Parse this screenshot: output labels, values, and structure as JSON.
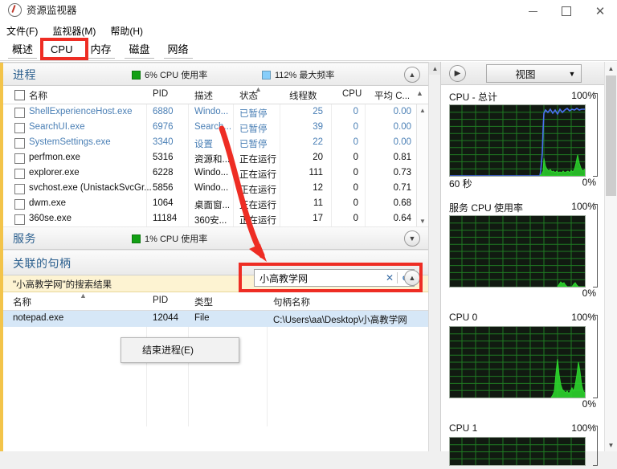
{
  "window": {
    "title": "资源监视器",
    "icon": "resource-monitor-icon",
    "controls": {
      "minimize": "–",
      "maximize": "▢",
      "close": "✕"
    }
  },
  "menu": [
    {
      "label": "文件(F)"
    },
    {
      "label": "监视器(M)"
    },
    {
      "label": "帮助(H)"
    }
  ],
  "tabs": [
    {
      "label": "概述",
      "active": false
    },
    {
      "label": "CPU",
      "active": true
    },
    {
      "label": "内存",
      "active": false
    },
    {
      "label": "磁盘",
      "active": false
    },
    {
      "label": "网络",
      "active": false
    }
  ],
  "processes_section": {
    "title": "进程",
    "legend": [
      {
        "label": "6% CPU 使用率",
        "color": "#12a014"
      },
      {
        "label": "112% 最大频率",
        "color": "#87cefa"
      }
    ],
    "collapse_icon": "chevron-up-icon",
    "columns": [
      {
        "key": "name",
        "label": "名称"
      },
      {
        "key": "pid",
        "label": "PID"
      },
      {
        "key": "desc",
        "label": "描述"
      },
      {
        "key": "status",
        "label": "状态"
      },
      {
        "key": "threads",
        "label": "线程数"
      },
      {
        "key": "cpu",
        "label": "CPU"
      },
      {
        "key": "avgcpu",
        "label": "平均 C..."
      }
    ],
    "sorted_column": "状态",
    "rows": [
      {
        "name": "ShellExperienceHost.exe",
        "pid": "6880",
        "desc": "Windo...",
        "status": "已暂停",
        "threads": "25",
        "cpu": "0",
        "avgcpu": "0.00",
        "dim": true
      },
      {
        "name": "SearchUI.exe",
        "pid": "6976",
        "desc": "Search...",
        "status": "已暂停",
        "threads": "39",
        "cpu": "0",
        "avgcpu": "0.00",
        "dim": true
      },
      {
        "name": "SystemSettings.exe",
        "pid": "3340",
        "desc": "设置",
        "status": "已暂停",
        "threads": "22",
        "cpu": "0",
        "avgcpu": "0.00",
        "dim": true
      },
      {
        "name": "perfmon.exe",
        "pid": "5316",
        "desc": "资源和...",
        "status": "正在运行",
        "threads": "20",
        "cpu": "0",
        "avgcpu": "0.81",
        "dim": false
      },
      {
        "name": "explorer.exe",
        "pid": "6228",
        "desc": "Windo...",
        "status": "正在运行",
        "threads": "111",
        "cpu": "0",
        "avgcpu": "0.73",
        "dim": false
      },
      {
        "name": "svchost.exe (UnistackSvcGr...",
        "pid": "5856",
        "desc": "Windo...",
        "status": "正在运行",
        "threads": "12",
        "cpu": "0",
        "avgcpu": "0.71",
        "dim": false
      },
      {
        "name": "dwm.exe",
        "pid": "1064",
        "desc": "桌面窗...",
        "status": "正在运行",
        "threads": "11",
        "cpu": "0",
        "avgcpu": "0.68",
        "dim": false
      },
      {
        "name": "360se.exe",
        "pid": "11184",
        "desc": "360安...",
        "status": "正在运行",
        "threads": "17",
        "cpu": "0",
        "avgcpu": "0.64",
        "dim": false
      }
    ]
  },
  "services_section": {
    "title": "服务",
    "legend": [
      {
        "label": "1% CPU 使用率",
        "color": "#12a014"
      }
    ],
    "collapse_icon": "chevron-down-icon"
  },
  "handles_section": {
    "title": "关联的句柄",
    "search": {
      "value": "小高教学网",
      "clear_icon": "clear-x-icon",
      "find_icon": "search-refresh-icon"
    },
    "collapse_icon": "chevron-up-icon",
    "result_banner": "\"小高教学网\"的搜索结果",
    "columns": [
      {
        "key": "name",
        "label": "名称"
      },
      {
        "key": "pid",
        "label": "PID"
      },
      {
        "key": "type",
        "label": "类型"
      },
      {
        "key": "handle",
        "label": "句柄名称"
      }
    ],
    "rows": [
      {
        "name": "notepad.exe",
        "pid": "12044",
        "type": "File",
        "handle": "C:\\Users\\aa\\Desktop\\小高教学网",
        "selected": true
      }
    ],
    "context_menu": [
      {
        "label": "结束进程(E)"
      }
    ]
  },
  "right_pane": {
    "expand_icon": "chevron-right-icon",
    "view_button": "视图",
    "view_dropdown_icon": "chevron-down-icon",
    "graphs": [
      {
        "title": "CPU - 总计",
        "max": "100%",
        "min": "0%",
        "unit": "60 秒"
      },
      {
        "title": "服务 CPU 使用率",
        "max": "100%",
        "min": "0%",
        "unit": ""
      },
      {
        "title": "CPU 0",
        "max": "100%",
        "min": "0%",
        "unit": ""
      },
      {
        "title": "CPU 1",
        "max": "100%",
        "min": "",
        "unit": ""
      }
    ]
  },
  "annotations": {
    "cpu_tab_box": "red-highlight-cpu-tab",
    "search_box": "red-highlight-search",
    "arrow": "red-arrow-pointing-to-search"
  },
  "colors": {
    "accent_blue": "#2b5f8e",
    "legend_green": "#12a014",
    "legend_blue": "#87cefa",
    "annotation_red": "#ee2d24",
    "banner_yellow": "#fdf3d2",
    "selection_blue": "#d6e7f7"
  },
  "chart_data": [
    {
      "type": "line",
      "title": "CPU - 总计",
      "ylim": [
        0,
        100
      ],
      "ylabel": "%",
      "xlabel": "60 秒",
      "grid": true,
      "series": [
        {
          "name": "最大频率",
          "color": "#4a6ff0",
          "values": [
            0,
            0,
            0,
            0,
            0,
            0,
            0,
            0,
            0,
            0,
            0,
            0,
            0,
            0,
            0,
            0,
            0,
            0,
            0,
            0,
            0,
            0,
            0,
            0,
            0,
            0,
            0,
            0,
            0,
            0,
            0,
            0,
            0,
            0,
            0,
            0,
            0,
            0,
            0,
            0,
            0,
            0,
            0,
            0,
            0,
            0,
            0,
            0,
            0,
            0,
            0,
            0,
            0,
            0,
            0,
            0,
            0,
            6,
            95,
            92,
            96,
            93,
            97,
            92,
            96,
            93,
            91,
            95,
            93,
            97,
            93,
            95,
            96,
            94,
            97,
            95,
            94,
            96,
            95
          ]
        },
        {
          "name": "CPU 使用率",
          "color": "#2cd42c",
          "values": [
            0,
            0,
            0,
            0,
            0,
            0,
            0,
            0,
            0,
            0,
            0,
            0,
            0,
            0,
            0,
            0,
            0,
            0,
            0,
            0,
            0,
            0,
            0,
            0,
            0,
            0,
            0,
            0,
            0,
            0,
            0,
            0,
            0,
            0,
            0,
            0,
            0,
            0,
            0,
            0,
            0,
            0,
            0,
            0,
            0,
            0,
            0,
            0,
            0,
            0,
            0,
            0,
            0,
            0,
            0,
            0,
            0,
            2,
            6,
            30,
            18,
            12,
            9,
            14,
            8,
            6,
            7,
            5,
            6,
            8,
            6,
            5,
            7,
            6,
            5,
            6,
            9,
            24,
            32
          ]
        }
      ]
    },
    {
      "type": "line",
      "title": "服务 CPU 使用率",
      "ylim": [
        0,
        100
      ],
      "ylabel": "%",
      "grid": true,
      "series": [
        {
          "name": "服务 CPU",
          "color": "#2cd42c",
          "values": [
            0,
            0,
            0,
            0,
            0,
            0,
            0,
            0,
            0,
            0,
            0,
            0,
            0,
            0,
            0,
            0,
            0,
            0,
            0,
            0,
            0,
            0,
            0,
            0,
            0,
            0,
            0,
            0,
            0,
            0,
            0,
            0,
            0,
            0,
            0,
            0,
            0,
            0,
            0,
            0,
            0,
            0,
            0,
            0,
            0,
            0,
            0,
            0,
            0,
            0,
            0,
            0,
            0,
            0,
            0,
            0,
            0,
            0,
            0,
            0,
            0,
            0,
            0,
            0,
            0,
            0,
            0,
            0,
            0,
            0,
            0,
            3,
            5,
            2,
            4,
            1,
            0,
            3,
            6
          ]
        }
      ]
    },
    {
      "type": "line",
      "title": "CPU 0",
      "ylim": [
        0,
        100
      ],
      "ylabel": "%",
      "grid": true,
      "series": [
        {
          "name": "CPU 0",
          "color": "#2cd42c",
          "values": [
            0,
            0,
            0,
            0,
            0,
            0,
            0,
            0,
            0,
            0,
            0,
            0,
            0,
            0,
            0,
            0,
            0,
            0,
            0,
            0,
            0,
            0,
            0,
            0,
            0,
            0,
            0,
            0,
            0,
            0,
            0,
            0,
            0,
            0,
            0,
            0,
            0,
            0,
            0,
            0,
            0,
            0,
            0,
            0,
            0,
            0,
            0,
            0,
            0,
            0,
            0,
            0,
            0,
            0,
            0,
            0,
            0,
            0,
            0,
            0,
            0,
            0,
            0,
            0,
            0,
            0,
            1,
            4,
            34,
            20,
            12,
            8,
            10,
            7,
            6,
            8,
            12,
            26,
            36
          ]
        }
      ]
    },
    {
      "type": "line",
      "title": "CPU 1",
      "ylim": [
        0,
        100
      ],
      "ylabel": "%",
      "grid": true,
      "series": [
        {
          "name": "CPU 1",
          "color": "#2cd42c",
          "values": [
            0,
            0,
            0,
            0,
            0,
            0,
            0,
            0,
            0,
            0,
            0,
            0,
            0,
            0,
            0,
            0,
            0,
            0,
            0,
            0,
            0,
            0,
            0,
            0,
            0,
            0,
            0,
            0,
            0,
            0
          ]
        }
      ]
    }
  ]
}
